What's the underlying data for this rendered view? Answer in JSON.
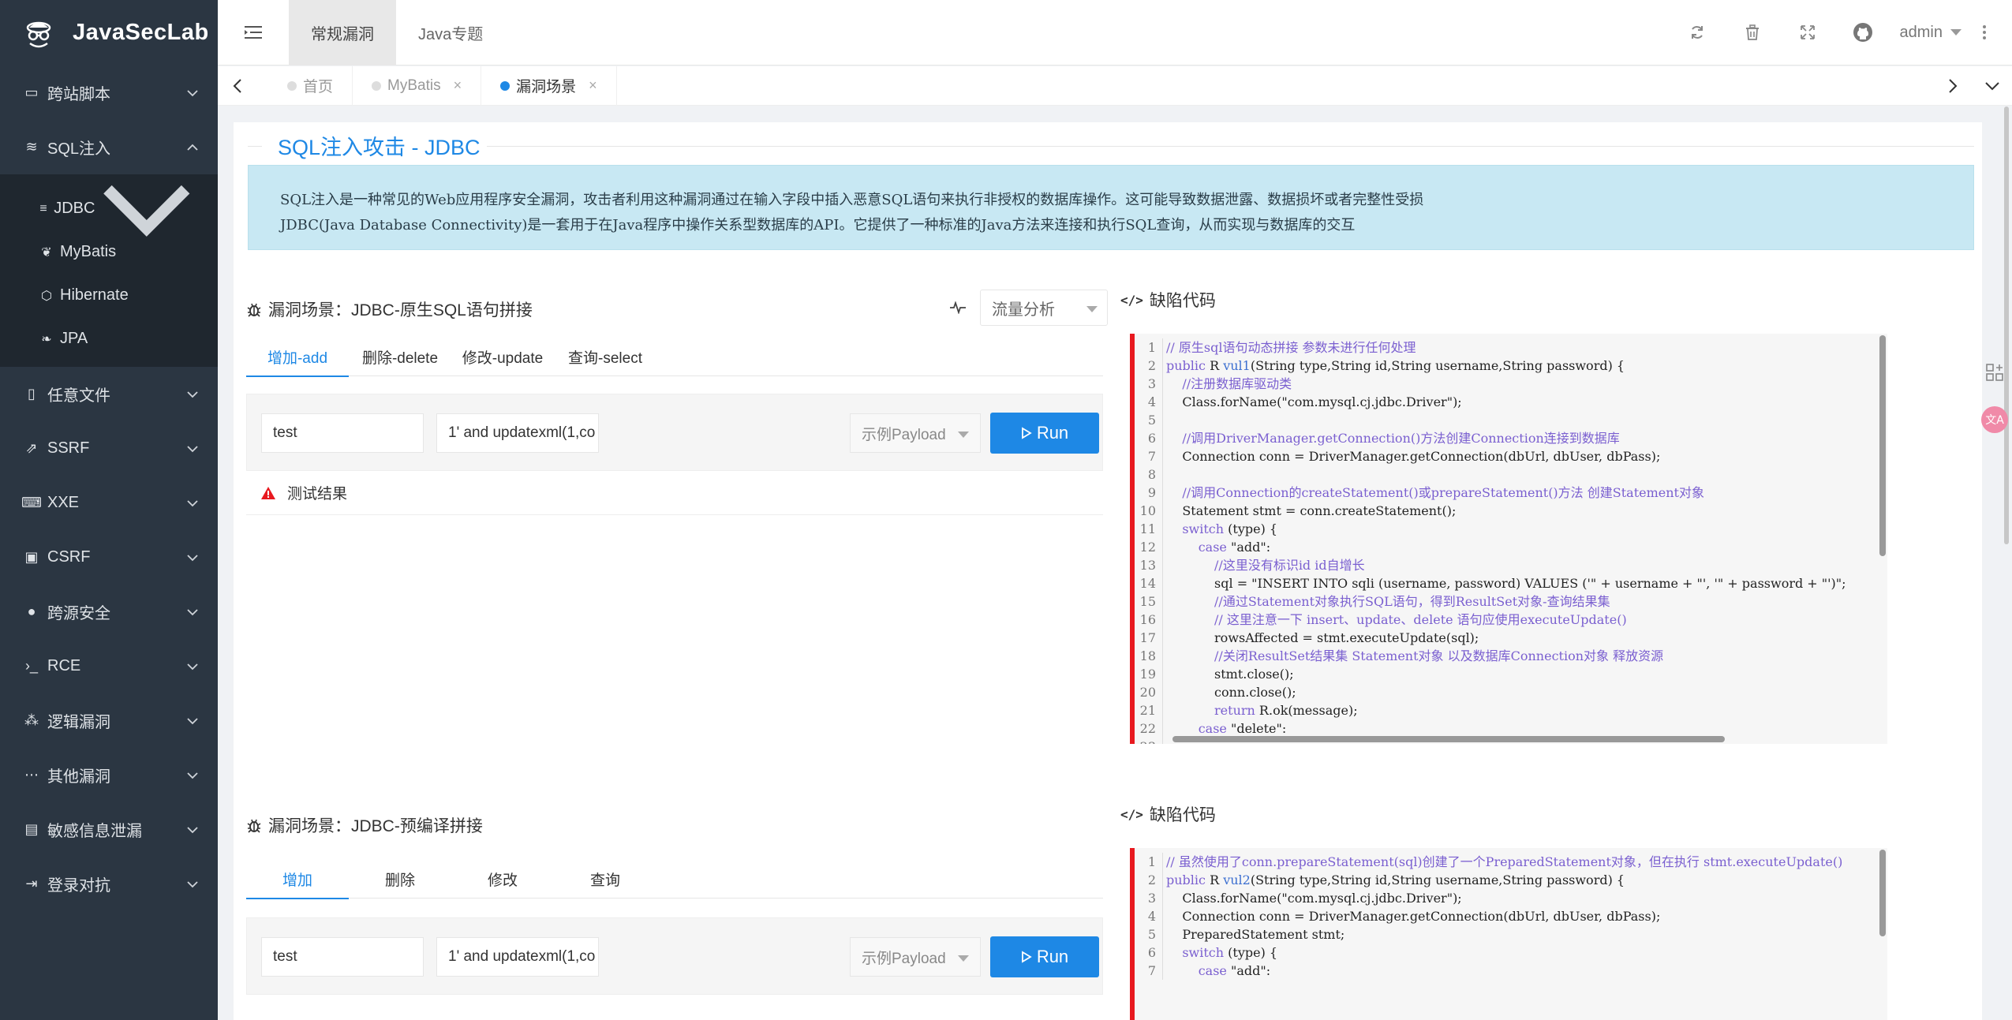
{
  "app": {
    "name": "JavaSecLab"
  },
  "sidebar": {
    "items": [
      {
        "label": "跨站脚本",
        "icon": "browser-icon",
        "expanded": false
      },
      {
        "label": "SQL注入",
        "icon": "database-icon",
        "expanded": true
      },
      {
        "label": "任意文件",
        "icon": "file-icon",
        "expanded": false
      },
      {
        "label": "SSRF",
        "icon": "external-link-icon",
        "expanded": false
      },
      {
        "label": "XXE",
        "icon": "code-file-icon",
        "expanded": false
      },
      {
        "label": "CSRF",
        "icon": "monitor-icon",
        "expanded": false
      },
      {
        "label": "跨源安全",
        "icon": "location-pin-icon",
        "expanded": false
      },
      {
        "label": "RCE",
        "icon": "terminal-icon",
        "expanded": false
      },
      {
        "label": "逻辑漏洞",
        "icon": "cluster-icon",
        "expanded": false
      },
      {
        "label": "其他漏洞",
        "icon": "more-dots-icon",
        "expanded": false
      },
      {
        "label": "敏感信息泄漏",
        "icon": "document-lock-icon",
        "expanded": false
      },
      {
        "label": "登录对抗",
        "icon": "login-icon",
        "expanded": false
      }
    ],
    "sql_sub": [
      {
        "label": "JDBC",
        "icon": "server-icon"
      },
      {
        "label": "MyBatis",
        "icon": "bird-icon"
      },
      {
        "label": "Hibernate",
        "icon": "hexagon-icon"
      },
      {
        "label": "JPA",
        "icon": "leaf-icon"
      }
    ]
  },
  "header": {
    "tabs": [
      "常规漏洞",
      "Java专题"
    ],
    "active_tab": 0,
    "user": "admin"
  },
  "pagetabs": [
    {
      "label": "首页",
      "closable": false,
      "active": false
    },
    {
      "label": "MyBatis",
      "closable": true,
      "active": false
    },
    {
      "label": "漏洞场景",
      "closable": true,
      "active": true
    }
  ],
  "page": {
    "title": "SQL注入攻击 - JDBC",
    "intro_1": "SQL注入是一种常见的Web应用程序安全漏洞，攻击者利用这种漏洞通过在输入字段中插入恶意SQL语句来执行非授权的数据库操作。这可能导致数据泄露、数据损坏或者完整性受损",
    "intro_2": "JDBC(Java Database Connectivity)是一套用于在Java程序中操作关系型数据库的API。它提供了一种标准的Java方法来连接和执行SQL查询，从而实现与数据库的交互"
  },
  "scene1": {
    "title": "漏洞场景：JDBC-原生SQL语句拼接",
    "flow_label": "流量分析",
    "tabs": [
      "增加-add",
      "删除-delete",
      "修改-update",
      "查询-select"
    ],
    "username_value": "test",
    "password_value": "1' and updatexml(1,co",
    "payload_label": "示例Payload",
    "run_label": "Run",
    "result_label": "测试结果",
    "code_title": "缺陷代码",
    "code": [
      {
        "n": "1",
        "t": "// 原生sql语句动态拼接 参数未进行任何处理",
        "k": "cm"
      },
      {
        "n": "2",
        "t": "public R vul1(String type,String id,String username,String password) {",
        "k": "sig"
      },
      {
        "n": "3",
        "t": "    //注册数据库驱动类",
        "k": "cm"
      },
      {
        "n": "4",
        "t": "    Class.forName(\"com.mysql.cj.jdbc.Driver\");",
        "k": "tx"
      },
      {
        "n": "5",
        "t": "",
        "k": "tx"
      },
      {
        "n": "6",
        "t": "    //调用DriverManager.getConnection()方法创建Connection连接到数据库",
        "k": "cm"
      },
      {
        "n": "7",
        "t": "    Connection conn = DriverManager.getConnection(dbUrl, dbUser, dbPass);",
        "k": "tx"
      },
      {
        "n": "8",
        "t": "",
        "k": "tx"
      },
      {
        "n": "9",
        "t": "    //调用Connection的createStatement()或prepareStatement()方法 创建Statement对象",
        "k": "cm"
      },
      {
        "n": "10",
        "t": "    Statement stmt = conn.createStatement();",
        "k": "tx"
      },
      {
        "n": "11",
        "t": "    switch (type) {",
        "k": "kw"
      },
      {
        "n": "12",
        "t": "        case \"add\":",
        "k": "kw"
      },
      {
        "n": "13",
        "t": "            //这里没有标识id id自增长",
        "k": "cm"
      },
      {
        "n": "14",
        "t": "            sql = \"INSERT INTO sqli (username, password) VALUES ('\" + username + \"', '\" + password + \"')\";",
        "k": "tx"
      },
      {
        "n": "15",
        "t": "            //通过Statement对象执行SQL语句，得到ResultSet对象-查询结果集",
        "k": "cm"
      },
      {
        "n": "16",
        "t": "            // 这里注意一下 insert、update、delete 语句应使用executeUpdate()",
        "k": "cm"
      },
      {
        "n": "17",
        "t": "            rowsAffected = stmt.executeUpdate(sql);",
        "k": "tx"
      },
      {
        "n": "18",
        "t": "            //关闭ResultSet结果集 Statement对象 以及数据库Connection对象 释放资源",
        "k": "cm"
      },
      {
        "n": "19",
        "t": "            stmt.close();",
        "k": "tx"
      },
      {
        "n": "20",
        "t": "            conn.close();",
        "k": "tx"
      },
      {
        "n": "21",
        "t": "            return R.ok(message);",
        "k": "ret"
      },
      {
        "n": "22",
        "t": "        case \"delete\":",
        "k": "kw"
      },
      {
        "n": "23",
        "t": "",
        "k": "tx"
      }
    ]
  },
  "scene2": {
    "title": "漏洞场景：JDBC-预编译拼接",
    "tabs": [
      "增加",
      "删除",
      "修改",
      "查询"
    ],
    "username_value": "test",
    "password_value": "1' and updatexml(1,co",
    "payload_label": "示例Payload",
    "run_label": "Run",
    "code_title": "缺陷代码",
    "code": [
      {
        "n": "1",
        "t": "// 虽然使用了conn.prepareStatement(sql)创建了一个PreparedStatement对象，但在执行 stmt.executeUpdate()",
        "k": "cm"
      },
      {
        "n": "2",
        "t": "public R vul2(String type,String id,String username,String password) {",
        "k": "sig"
      },
      {
        "n": "3",
        "t": "    Class.forName(\"com.mysql.cj.jdbc.Driver\");",
        "k": "tx"
      },
      {
        "n": "4",
        "t": "    Connection conn = DriverManager.getConnection(dbUrl, dbUser, dbPass);",
        "k": "tx"
      },
      {
        "n": "5",
        "t": "    PreparedStatement stmt;",
        "k": "tx"
      },
      {
        "n": "6",
        "t": "    switch (type) {",
        "k": "kw"
      },
      {
        "n": "7",
        "t": "        case \"add\":",
        "k": "kw"
      }
    ]
  },
  "colors": {
    "accent": "#1e88e5",
    "danger": "#e8191f",
    "sidebar": "#2b3642",
    "intro_bg": "#c8e8f3"
  }
}
